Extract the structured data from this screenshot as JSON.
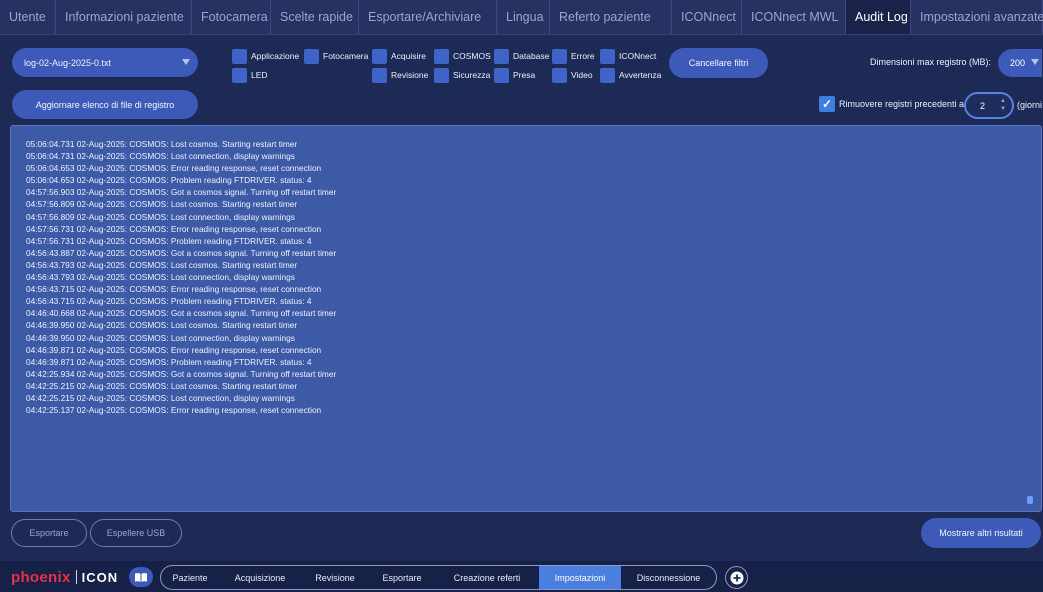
{
  "tabs": [
    {
      "label": "Utente"
    },
    {
      "label": "Informazioni paziente"
    },
    {
      "label": "Fotocamera"
    },
    {
      "label": "Scelte rapide"
    },
    {
      "label": "Esportare/Archiviare"
    },
    {
      "label": "Lingua"
    },
    {
      "label": "Referto paziente"
    },
    {
      "label": "ICONnect"
    },
    {
      "label": "ICONnect MWL"
    },
    {
      "label": "Audit Log",
      "active": true
    },
    {
      "label": "Impostazioni avanzate"
    }
  ],
  "controls": {
    "log_file_value": "log-02-Aug-2025-0.txt",
    "refresh_label": "Aggiornare elenco di file di registro",
    "filters": {
      "applicazione": "Applicazione",
      "fotocamera": "Fotocamera",
      "acquisire": "Acquisire",
      "cosmos": "COSMOS",
      "database": "Database",
      "errore": "Errore",
      "iconnect": "ICONnect",
      "led": "LED",
      "revisione": "Revisione",
      "sicurezza": "Sicurezza",
      "presa": "Presa",
      "video": "Video",
      "avvertenza": "Avvertenza"
    },
    "clear_filters_label": "Cancellare filtri",
    "max_size_label": "Dimensioni max registro (MB):",
    "max_size_value": "200",
    "remove_older_label": "Rimuovere registri precedenti a",
    "remove_older_checked": true,
    "days_value": "2",
    "days_unit": "(giorni"
  },
  "log": [
    "05:06:04.731 02-Aug-2025: COSMOS: Lost cosmos. Starting restart timer",
    "05:06:04.731 02-Aug-2025: COSMOS: Lost connection, display warnings",
    "05:06:04.653 02-Aug-2025: COSMOS: Error reading response, reset connection",
    "05:06:04.653 02-Aug-2025: COSMOS: Problem reading FTDRIVER. status: 4",
    "04:57:56.903 02-Aug-2025: COSMOS: Got a cosmos signal. Turning off restart timer",
    "04:57:56.809 02-Aug-2025: COSMOS: Lost cosmos. Starting restart timer",
    "04:57:56.809 02-Aug-2025: COSMOS: Lost connection, display warnings",
    "04:57:56.731 02-Aug-2025: COSMOS: Error reading response, reset connection",
    "04:57:56.731 02-Aug-2025: COSMOS: Problem reading FTDRIVER. status: 4",
    "04:56:43.887 02-Aug-2025: COSMOS: Got a cosmos signal. Turning off restart timer",
    "04:56:43.793 02-Aug-2025: COSMOS: Lost cosmos. Starting restart timer",
    "04:56:43.793 02-Aug-2025: COSMOS: Lost connection, display warnings",
    "04:56:43.715 02-Aug-2025: COSMOS: Error reading response, reset connection",
    "04:56:43.715 02-Aug-2025: COSMOS: Problem reading FTDRIVER. status: 4",
    "04:46:40.668 02-Aug-2025: COSMOS: Got a cosmos signal. Turning off restart timer",
    "04:46:39.950 02-Aug-2025: COSMOS: Lost cosmos. Starting restart timer",
    "04:46:39.950 02-Aug-2025: COSMOS: Lost connection, display warnings",
    "04:46:39.871 02-Aug-2025: COSMOS: Error reading response, reset connection",
    "04:46:39.871 02-Aug-2025: COSMOS: Problem reading FTDRIVER. status: 4",
    "04:42:25.934 02-Aug-2025: COSMOS: Got a cosmos signal. Turning off restart timer",
    "04:42:25.215 02-Aug-2025: COSMOS: Lost cosmos. Starting restart timer",
    "04:42:25.215 02-Aug-2025: COSMOS: Lost connection, display warnings",
    "04:42:25.137 02-Aug-2025: COSMOS: Error reading response, reset connection"
  ],
  "actions": {
    "export_label": "Esportare",
    "eject_usb_label": "Espellere USB",
    "show_more_label": "Mostrare altri risultati"
  },
  "bottom": {
    "brand_phoenix": "phoenix",
    "brand_icon": "ICON",
    "nav": [
      {
        "label": "Paziente"
      },
      {
        "label": "Acquisizione"
      },
      {
        "label": "Revisione"
      },
      {
        "label": "Esportare"
      },
      {
        "label": "Creazione referti"
      },
      {
        "label": "Impostazioni",
        "active": true
      },
      {
        "label": "Disconnessione"
      }
    ]
  },
  "colors": {
    "background": "#1e2a56",
    "button": "#3d5ab8",
    "active_nav": "#4a7fe0",
    "log_panel": "#3d5aa6",
    "brand_red": "#e3334a"
  },
  "icons": [
    "chevron-down-icon",
    "checkbox-icon",
    "checkmark-icon",
    "stepper-arrows-icon",
    "book-icon",
    "plus-icon",
    "scroll-thumb"
  ]
}
